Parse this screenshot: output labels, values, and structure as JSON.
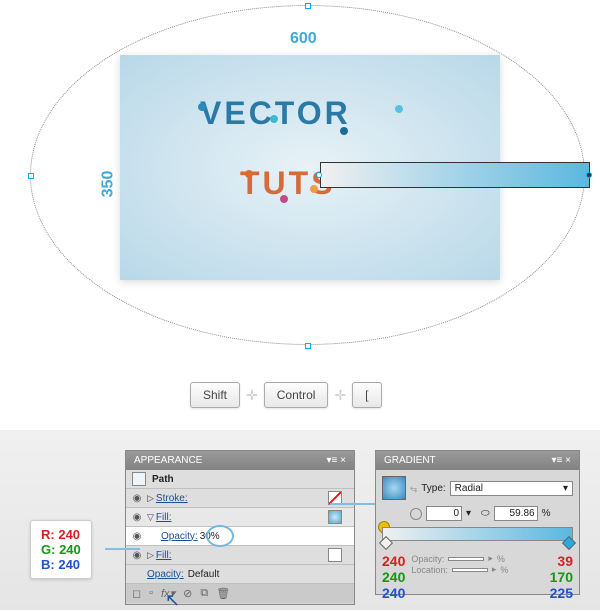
{
  "canvas": {
    "width_label": "600",
    "height_label": "350"
  },
  "artwork": {
    "line1": "VECTOR",
    "line2": "TUTS"
  },
  "keys": {
    "k1": "Shift",
    "k2": "Control",
    "k3": "["
  },
  "appearance": {
    "title": "APPEARANCE",
    "object": "Path",
    "stroke_label": "Stroke:",
    "fill_label": "Fill:",
    "opacity_label": "Opacity:",
    "opacity_value": "30%",
    "fill2_label": "Fill:",
    "opacity2_label": "Opacity:",
    "opacity2_value": "Default"
  },
  "rgb_left": {
    "r_label": "R:",
    "r": "240",
    "g_label": "G:",
    "g": "240",
    "b_label": "B:",
    "b": "240"
  },
  "gradient": {
    "title": "GRADIENT",
    "type_label": "Type:",
    "type_value": "Radial",
    "angle": "0",
    "aspect": "59.86",
    "pct": "%",
    "opacity_label": "Opacity:",
    "location_label": "Location:",
    "stop_left": {
      "r": "240",
      "g": "240",
      "b": "240"
    },
    "stop_right": {
      "r": "39",
      "g": "170",
      "b": "225"
    }
  }
}
